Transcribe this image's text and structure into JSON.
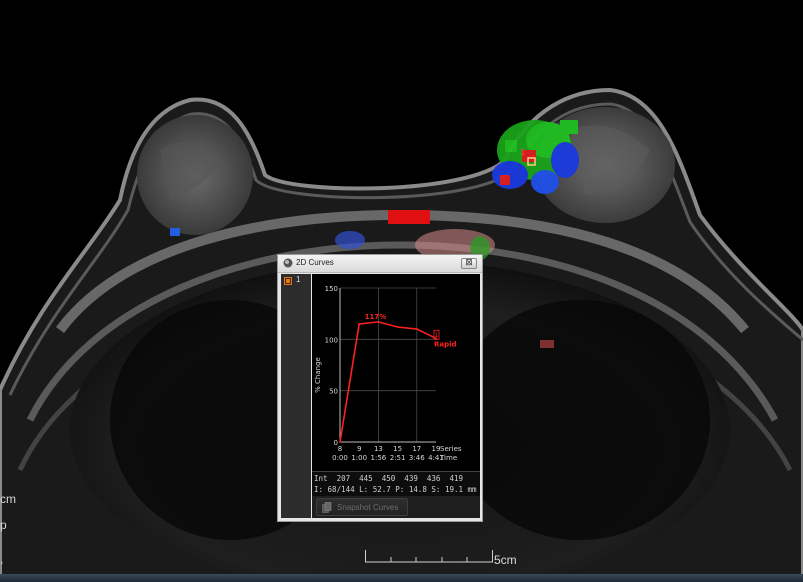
{
  "viewer": {
    "left_labels": [
      "cm",
      "p",
      ","
    ],
    "scale_label": "5cm"
  },
  "window": {
    "title": "2D Curves",
    "close_glyph": "⊠",
    "series_number": "1",
    "snapshot_label": "Snapshot Curves",
    "readout_int": "Int  207  445  450  439  436  419",
    "readout_info": "I: 68/144 L: 52.7 P: 14.8 S: 19.1 mm"
  },
  "chart_data": {
    "type": "line",
    "ylabel": "% Change",
    "ylim": [
      0,
      150
    ],
    "yticks": [
      "150",
      "100",
      "50",
      "0"
    ],
    "x_series_ticks": [
      "8",
      "9",
      "13",
      "15",
      "17",
      "19"
    ],
    "x_time_ticks": [
      "0:00",
      "1:00",
      "1:56",
      "2:51",
      "3:46",
      "4:41"
    ],
    "x_series_label": "Series",
    "x_time_label": "Time",
    "series": [
      {
        "name": "1",
        "color": "#ff2020",
        "values": [
          0,
          115,
          117,
          112,
          110,
          101
        ]
      }
    ],
    "annotations": {
      "peak": "117%",
      "curve_type": "Rapid",
      "marker": "1"
    },
    "grid": true
  },
  "colors": {
    "curve": "#ff2020",
    "axis": "#bbbbbb",
    "grid": "#4a4a4a",
    "label": "#d8d8d8"
  }
}
